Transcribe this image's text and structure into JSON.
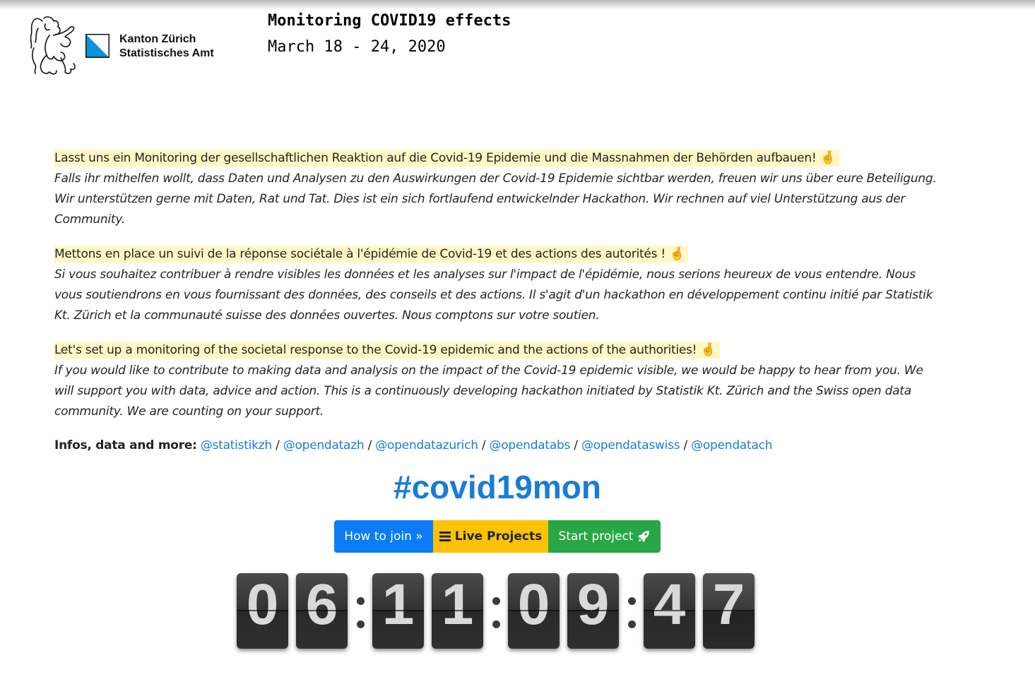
{
  "header": {
    "org_line1": "Kanton Zürich",
    "org_line2": "Statistisches Amt",
    "title": "Monitoring COVID19 effects",
    "dates": "March 18 - 24, 2020"
  },
  "intro": {
    "de": {
      "headline": "Lasst uns ein Monitoring der gesellschaftlichen Reaktion auf die Covid-19 Epidemie und die Massnahmen der Behörden aufbauen!",
      "body": "Falls ihr mithelfen wollt, dass Daten und Analysen zu den Auswirkungen der Covid-19 Epidemie sichtbar werden, freuen wir uns über eure Beteiligung. Wir unterstützen gerne mit Daten, Rat und Tat. Dies ist ein sich fortlaufend entwickelnder Hackathon. Wir rechnen auf viel Unterstützung aus der Community."
    },
    "fr": {
      "headline": "Mettons en place un suivi de la réponse sociétale à l'épidémie de Covid-19 et des actions des autorités !",
      "body": "Si vous souhaitez contribuer à rendre visibles les données et les analyses sur l'impact de l'épidémie, nous serions heureux de vous entendre. Nous vous soutiendrons en vous fournissant des données, des conseils et des actions. Il s'agit d'un hackathon en développement continu initié par Statistik Kt. Zürich et la communauté suisse des données ouvertes. Nous comptons sur votre soutien."
    },
    "en": {
      "headline": "Let's set up a monitoring of the societal response to the Covid-19 epidemic and the actions of the authorities!",
      "body": "If you would like to contribute to making data and analysis on the impact of the Covid-19 epidemic visible, we would be happy to hear from you. We will support you with data, advice and action. This is a continuously developing hackathon initiated by Statistik Kt. Zürich and the Swiss open data community. We are counting on your support."
    },
    "emoji": "🤞"
  },
  "links": {
    "label": "Infos, data and more:",
    "separator": "/",
    "items": [
      "@statistikzh",
      "@opendatazh",
      "@opendatazurich",
      "@opendatabs",
      "@opendataswiss",
      "@opendatach"
    ]
  },
  "hashtag": "#covid19mon",
  "buttons": {
    "join": "How to join »",
    "live": "Live Projects",
    "start": "Start project"
  },
  "countdown": {
    "digits": [
      "0",
      "6",
      "1",
      "1",
      "0",
      "9",
      "4",
      "7"
    ],
    "separator": ":"
  },
  "colors": {
    "link": "#1a7bd8",
    "highlight": "#fff8c4",
    "btn_join": "#0b7cf6",
    "btn_live": "#fdc106",
    "btn_start": "#27a745",
    "flag_blue": "#0a93dc"
  }
}
